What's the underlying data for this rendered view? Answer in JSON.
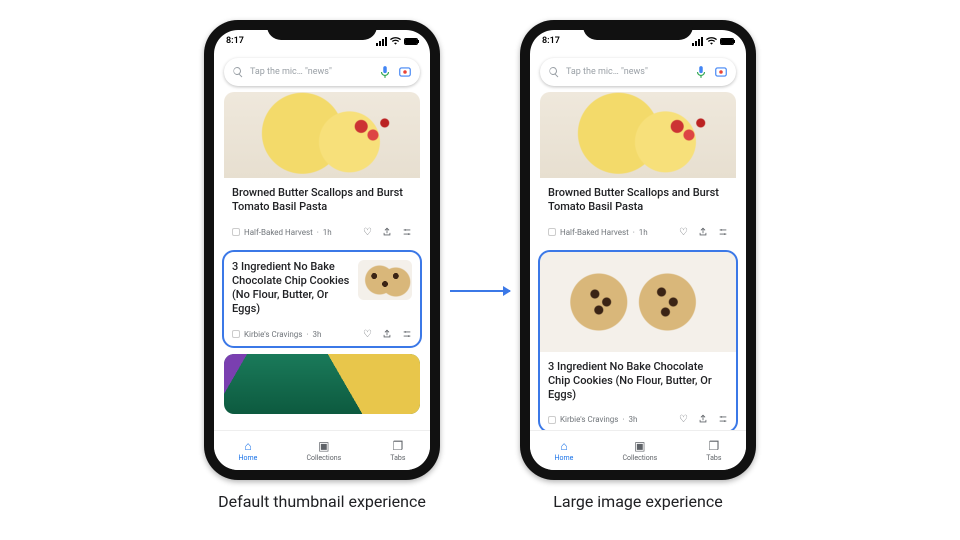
{
  "captions": {
    "left": "Default thumbnail experience",
    "right": "Large image experience"
  },
  "status": {
    "time": "8:17"
  },
  "search": {
    "placeholder": "Tap the mic… \"news\""
  },
  "cards": {
    "pasta": {
      "title": "Browned Butter Scallops and Burst Tomato Basil Pasta",
      "source": "Half-Baked Harvest",
      "age": "1h"
    },
    "cookies": {
      "title": "3 Ingredient No Bake Chocolate Chip Cookies (No Flour, Butter, Or Eggs)",
      "source": "Kirbie's Cravings",
      "age": "3h"
    }
  },
  "nav": {
    "home": "Home",
    "collections": "Collections",
    "tabs": "Tabs"
  }
}
